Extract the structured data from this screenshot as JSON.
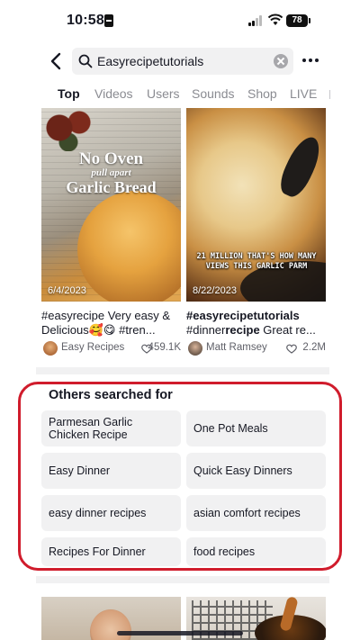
{
  "status_bar": {
    "time": "10:58",
    "battery": "78"
  },
  "search": {
    "query": "Easyrecipetutorials"
  },
  "tabs": [
    {
      "label": "Top",
      "active": true
    },
    {
      "label": "Videos",
      "active": false
    },
    {
      "label": "Users",
      "active": false
    },
    {
      "label": "Sounds",
      "active": false
    },
    {
      "label": "Shop",
      "active": false
    },
    {
      "label": "LIVE",
      "active": false
    }
  ],
  "videos": [
    {
      "overlay_line1": "No Oven",
      "overlay_line2": "pull apart",
      "overlay_line3": "Garlic Bread",
      "date": "6/4/2023",
      "description": "#easyrecipe  Very easy & Delicious🥰😋 #tren...",
      "author": "Easy Recipes",
      "likes": "459.1K"
    },
    {
      "overlay_caption": "21 MILLION THAT'S HOW MANY VIEWS THIS GARLIC PARM",
      "date": "8/22/2023",
      "description_parts": [
        "#easyrecipe",
        "tutorials",
        " #dinner",
        "recipe",
        " Great re..."
      ],
      "author": "Matt Ramsey",
      "likes": "2.2M"
    }
  ],
  "others_searched": {
    "title": "Others searched for",
    "items": [
      "Parmesan Garlic Chicken Recipe",
      "One Pot Meals",
      "Easy Dinner",
      "Quick Easy Dinners",
      "easy dinner recipes",
      "asian comfort recipes",
      "Recipes For Dinner",
      "food recipes"
    ],
    "highlight_color": "#d01c2c"
  }
}
